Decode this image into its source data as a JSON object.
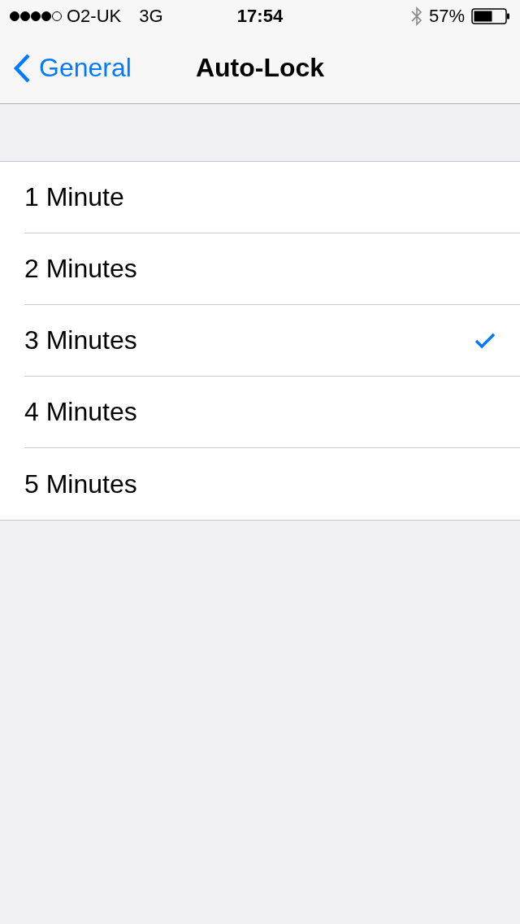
{
  "status_bar": {
    "carrier": "O2-UK",
    "network": "3G",
    "time": "17:54",
    "battery": "57%"
  },
  "nav_bar": {
    "back": "General",
    "title": "Auto-Lock"
  },
  "options": [
    {
      "label": "1 Minute",
      "selected": false
    },
    {
      "label": "2 Minutes",
      "selected": false
    },
    {
      "label": "3 Minutes",
      "selected": true
    },
    {
      "label": "4 Minutes",
      "selected": false
    },
    {
      "label": "5 Minutes",
      "selected": false
    }
  ]
}
